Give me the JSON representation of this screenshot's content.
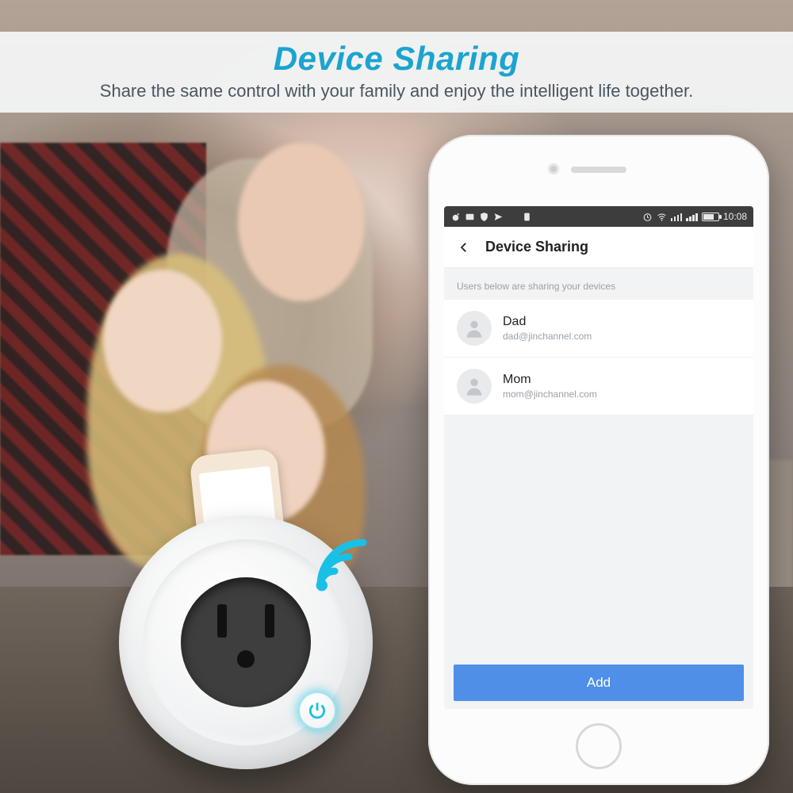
{
  "banner": {
    "title": "Device Sharing",
    "subtitle": "Share the same control with your family and enjoy the intelligent life together."
  },
  "phone": {
    "statusbar": {
      "time": "10:08",
      "icons_left": [
        "weibo",
        "image",
        "shield",
        "telegram",
        "download",
        "sim"
      ],
      "icons_right": [
        "timer",
        "wifi",
        "signal-dual",
        "battery"
      ]
    },
    "app": {
      "screen_title": "Device Sharing",
      "hint": "Users below are sharing your devices",
      "users": [
        {
          "name": "Dad",
          "email": "dad@jinchannel.com"
        },
        {
          "name": "Mom",
          "email": "mom@jinchannel.com"
        }
      ],
      "add_label": "Add"
    }
  },
  "plug": {
    "power_icon": "power-icon",
    "wifi_icon": "wifi-icon",
    "accent": "#19c0e6"
  }
}
